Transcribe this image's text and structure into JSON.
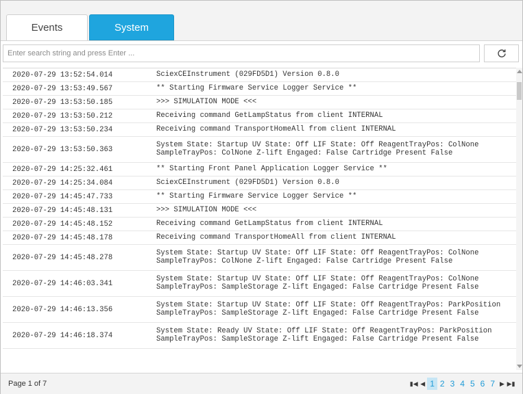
{
  "tabs": {
    "events": "Events",
    "system": "System",
    "active": "System"
  },
  "search": {
    "placeholder": "Enter search string and press Enter ...",
    "value": ""
  },
  "refresh_icon": "refresh-icon",
  "log": [
    {
      "timestamp": "2020-07-29 13:52:54.014",
      "message": "SciexCEInstrument (029FD5D1) Version 0.8.0"
    },
    {
      "timestamp": "2020-07-29 13:53:49.567",
      "message": "** Starting Firmware Service Logger Service **"
    },
    {
      "timestamp": "2020-07-29 13:53:50.185",
      "message": ">>> SIMULATION MODE <<<"
    },
    {
      "timestamp": "2020-07-29 13:53:50.212",
      "message": "Receiving command GetLampStatus from client INTERNAL"
    },
    {
      "timestamp": "2020-07-29 13:53:50.234",
      "message": "Receiving command TransportHomeAll from client INTERNAL"
    },
    {
      "timestamp": "2020-07-29 13:53:50.363",
      "message": "System State: Startup UV State: Off LIF State: Off ReagentTrayPos: ColNone SampleTrayPos: ColNone Z-lift Engaged: False Cartridge Present False"
    },
    {
      "timestamp": "2020-07-29 14:25:32.461",
      "message": "** Starting Front Panel Application Logger Service **"
    },
    {
      "timestamp": "2020-07-29 14:25:34.084",
      "message": "SciexCEInstrument (029FD5D1) Version 0.8.0"
    },
    {
      "timestamp": "2020-07-29 14:45:47.733",
      "message": "** Starting Firmware Service Logger Service **"
    },
    {
      "timestamp": "2020-07-29 14:45:48.131",
      "message": ">>> SIMULATION MODE <<<"
    },
    {
      "timestamp": "2020-07-29 14:45:48.152",
      "message": "Receiving command GetLampStatus from client INTERNAL"
    },
    {
      "timestamp": "2020-07-29 14:45:48.178",
      "message": "Receiving command TransportHomeAll from client INTERNAL"
    },
    {
      "timestamp": "2020-07-29 14:45:48.278",
      "message": "System State: Startup UV State: Off LIF State: Off ReagentTrayPos: ColNone SampleTrayPos: ColNone Z-lift Engaged: False Cartridge Present False"
    },
    {
      "timestamp": "2020-07-29 14:46:03.341",
      "message": "System State: Startup UV State: Off LIF State: Off ReagentTrayPos: ColNone SampleTrayPos: SampleStorage Z-lift Engaged: False Cartridge Present False"
    },
    {
      "timestamp": "2020-07-29 14:46:13.356",
      "message": "System State: Startup UV State: Off LIF State: Off ReagentTrayPos: ParkPosition SampleTrayPos: SampleStorage Z-lift Engaged: False Cartridge Present False"
    },
    {
      "timestamp": "2020-07-29 14:46:18.374",
      "message": "System State: Ready UV State: Off LIF State: Off ReagentTrayPos: ParkPosition SampleTrayPos: SampleStorage Z-lift Engaged: False Cartridge Present False"
    }
  ],
  "footer": {
    "page_info": "Page 1 of 7",
    "pages": [
      "1",
      "2",
      "3",
      "4",
      "5",
      "6",
      "7"
    ],
    "current_page": "1",
    "nav_icons": {
      "first": "first-page-icon",
      "prev": "prev-page-icon",
      "next": "next-page-icon",
      "last": "last-page-icon"
    }
  },
  "colors": {
    "accent": "#1fa5de",
    "page_link": "#1f9bd7",
    "active_page_bg": "#c7e6f5"
  }
}
